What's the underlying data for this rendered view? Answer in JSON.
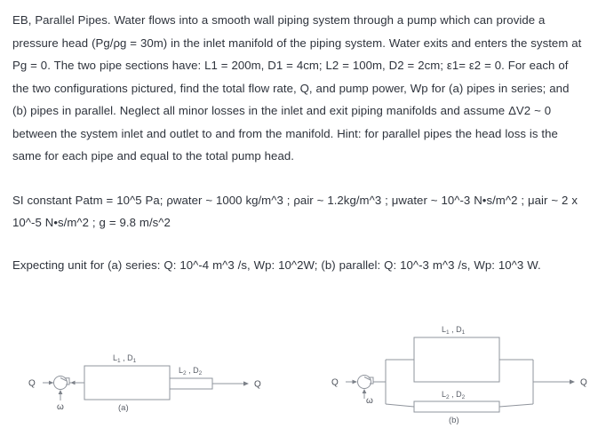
{
  "document": {
    "paragraphs": [
      "EB, Parallel Pipes. Water flows into a smooth wall piping system through a pump which can provide a pressure head (Pg/ρg = 30m) in the inlet manifold of the piping system. Water exits and enters the system at Pg = 0. The two pipe sections have: L1 = 200m, D1 = 4cm; L2 = 100m, D2 = 2cm; ε1= ε2 = 0. For each of the two configurations pictured, find the total flow rate, Q, and pump power, Wp for (a) pipes in series; and (b) pipes in parallel. Neglect all minor losses in the inlet and exit piping manifolds and assume ΔV2 ~ 0 between the system inlet and outlet to and from the manifold. Hint: for parallel pipes the head loss is the same for each pipe and equal to the total pump head.",
      "SI constant Patm = 10^5 Pa; ρwater ~ 1000 kg/m^3 ; ρair ~ 1.2kg/m^3 ; μwater ~ 10^-3 N•s/m^2 ; μair ~ 2 x 10^-5 N•s/m^2 ; g = 9.8 m/s^2",
      "Expecting unit for  (a) series: Q: 10^-4 m^3 /s, Wp: 10^2W; (b) parallel: Q: 10^-3 m^3 /s, Wp: 10^3 W."
    ]
  },
  "figure_a": {
    "caption": "(a)",
    "inlet_flow_label": "Q",
    "outlet_flow_label": "Q",
    "pump_shaft_label": "ω",
    "pipe1_label_main": "L",
    "pipe1_label_sub": "1",
    "pipe1_label_main2": "D",
    "pipe1_label_sub2": "1",
    "pipe2_label_main": "L",
    "pipe2_label_sub": "2",
    "pipe2_label_main2": "D",
    "pipe2_label_sub2": "2",
    "pipe1_label": "L₁ , D₁",
    "pipe2_label": "L₂ , D₂"
  },
  "figure_b": {
    "caption": "(b)",
    "inlet_flow_label": "Q",
    "outlet_flow_label": "Q",
    "pump_shaft_label": "ω",
    "pipe1_label": "L₁ , D₁",
    "pipe2_label": "L₂ , D₂"
  },
  "colors": {
    "text": "#2e333c",
    "line": "#8f949c",
    "background": "#ffffff"
  }
}
